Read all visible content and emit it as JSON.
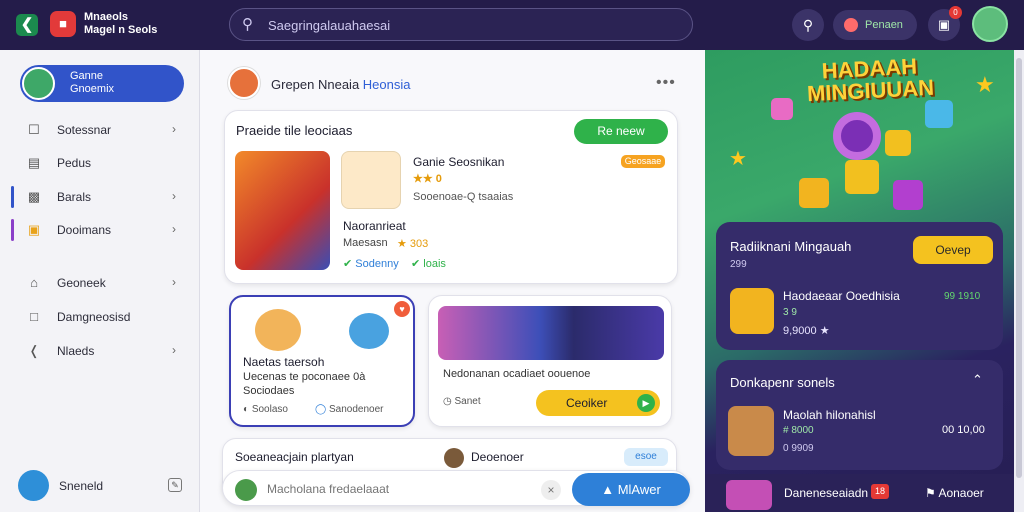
{
  "header": {
    "brand_line1": "Mnaeols",
    "brand_line2": "Magel n Seols",
    "search_placeholder": "Saegringalauahaesai",
    "pill_label": "Penaen",
    "notif_badge": "0"
  },
  "sidebar": {
    "profile_line1": "Ganne",
    "profile_line2": "Gnoemix",
    "items": [
      {
        "label": "Sotessnar",
        "icon": "clipboard-icon",
        "chevron": true
      },
      {
        "label": "Pedus",
        "icon": "file-icon",
        "chevron": false
      },
      {
        "label": "Barals",
        "icon": "image-icon",
        "chevron": true
      },
      {
        "label": "Dooimans",
        "icon": "folder-icon",
        "chevron": true
      },
      {
        "label": "Geoneek",
        "icon": "home-icon",
        "chevron": true
      },
      {
        "label": "Damgneosisd",
        "icon": "chat-icon",
        "chevron": false
      },
      {
        "label": "Nlaeds",
        "icon": "share-icon",
        "chevron": true
      }
    ],
    "footer_label": "Sneneld"
  },
  "main": {
    "group_title": "Grepen Nneaia",
    "group_title_highlight": "Heonsia",
    "card1": {
      "title": "Praeide tile leociaas",
      "button": "Re neew",
      "item_title": "Ganie Seosnikan",
      "item_tag": "Geosaae",
      "item_sub": "Sooenoae-Q tsaaias",
      "item_rating": "★★ 0",
      "item2_title": "Naoranrieat",
      "item2_sub": "Maesasn",
      "item2_stars": "★ 303",
      "status1": "Sodenny",
      "status2": "loais"
    },
    "card2": {
      "title": "Naetas taersoh",
      "line2": "Uecenas te poconaee 0à",
      "line3": "Sociodaes",
      "meta": "Soolaso",
      "meta2": "Sanodenoer"
    },
    "card3": {
      "line1": "Nedonanan ocadiaet oouenoe",
      "meta": "Sanet",
      "button": "Ceoiker"
    },
    "card4": {
      "title": "Soeaneacjain plartyan",
      "user": "Deoenoer",
      "tag": "esoe"
    },
    "compose_placeholder": "Macholana fredaelaaat",
    "send_label": "MlAwer"
  },
  "right": {
    "promo_title_line1": "HADAAH",
    "promo_title_line2": "MINGIUUAN",
    "panel1": {
      "title": "Radiiknani Mingauah",
      "subtitle": "299",
      "button": "Oevep",
      "item_title": "Haodaeaar Ooedhisia",
      "item_badge": "99 1910",
      "item_sub1": "3 9",
      "item_sub2": "9,9000 ★"
    },
    "panel2": {
      "title": "Donkapenr sonels",
      "item_title": "Maolah hilonahisl",
      "item_sub": "# 8000",
      "item_sub2": "0 9909",
      "item_count": "00 10,00"
    },
    "panel3": {
      "item_title": "Daneneseaiadn",
      "item_badge": "18",
      "action": "Aonaoer"
    }
  }
}
